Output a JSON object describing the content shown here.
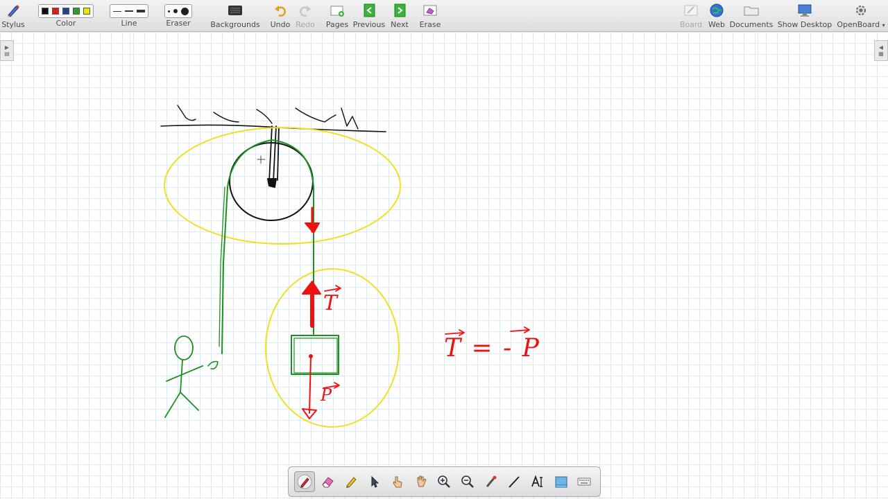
{
  "toolbar": {
    "stylus": "Stylus",
    "color": "Color",
    "line": "Line",
    "eraser": "Eraser",
    "backgrounds": "Backgrounds",
    "undo": "Undo",
    "redo": "Redo",
    "pages": "Pages",
    "previous": "Previous",
    "next": "Next",
    "erase": "Erase",
    "board": "Board",
    "web": "Web",
    "documents": "Documents",
    "show_desktop": "Show Desktop",
    "openboard": "OpenBoard",
    "colors": [
      "#111111",
      "#e3161b",
      "#1f3f9a",
      "#2aa12e",
      "#f3e400"
    ]
  },
  "board": {
    "background": "grid",
    "grid_color": "#d6ebf2",
    "annotation_equation": "T = - P",
    "label_tension": "T",
    "label_weight": "P",
    "ink_colors": {
      "black": "#111111",
      "green": "#1e8f1e",
      "red": "#ee1111",
      "yellow": "#f0e020"
    }
  },
  "bottom_tools": [
    "pen-icon",
    "eraser-icon",
    "highlighter-icon",
    "select-icon",
    "interact-icon",
    "hand-icon",
    "zoom-in-icon",
    "zoom-out-icon",
    "laser-pointer-icon",
    "line-icon",
    "text-icon",
    "capture-icon",
    "keyboard-icon"
  ]
}
